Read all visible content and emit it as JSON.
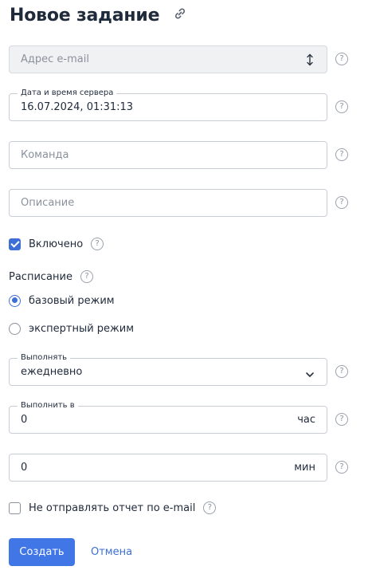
{
  "header": {
    "title": "Новое задание",
    "link_icon": "link-icon"
  },
  "email_field": {
    "placeholder": "Адрес e-mail",
    "disabled": true,
    "icon": "sort-arrows-icon"
  },
  "datetime_field": {
    "legend": "Дата и время сервера",
    "value": "16.07.2024, 01:31:13"
  },
  "command_field": {
    "placeholder": "Команда"
  },
  "description_field": {
    "placeholder": "Описание"
  },
  "enabled": {
    "label": "Включено",
    "checked": true
  },
  "schedule": {
    "label": "Расписание",
    "options": [
      {
        "label": "базовый режим",
        "selected": true
      },
      {
        "label": "экспертный режим",
        "selected": false
      }
    ]
  },
  "run_field": {
    "legend": "Выполнять",
    "value": "ежедневно"
  },
  "run_at_field": {
    "legend": "Выполнить в",
    "value": "0",
    "suffix": "час"
  },
  "minutes_field": {
    "value": "0",
    "suffix": "мин"
  },
  "no_report": {
    "label": "Не отправлять отчет по e-mail",
    "checked": false
  },
  "actions": {
    "create_label": "Создать",
    "cancel_label": "Отмена"
  },
  "help_glyph": "?",
  "colors": {
    "accent": "#4176e6",
    "text": "#1f2a3b",
    "placeholder": "#8a919c",
    "border": "#c9ced6"
  }
}
